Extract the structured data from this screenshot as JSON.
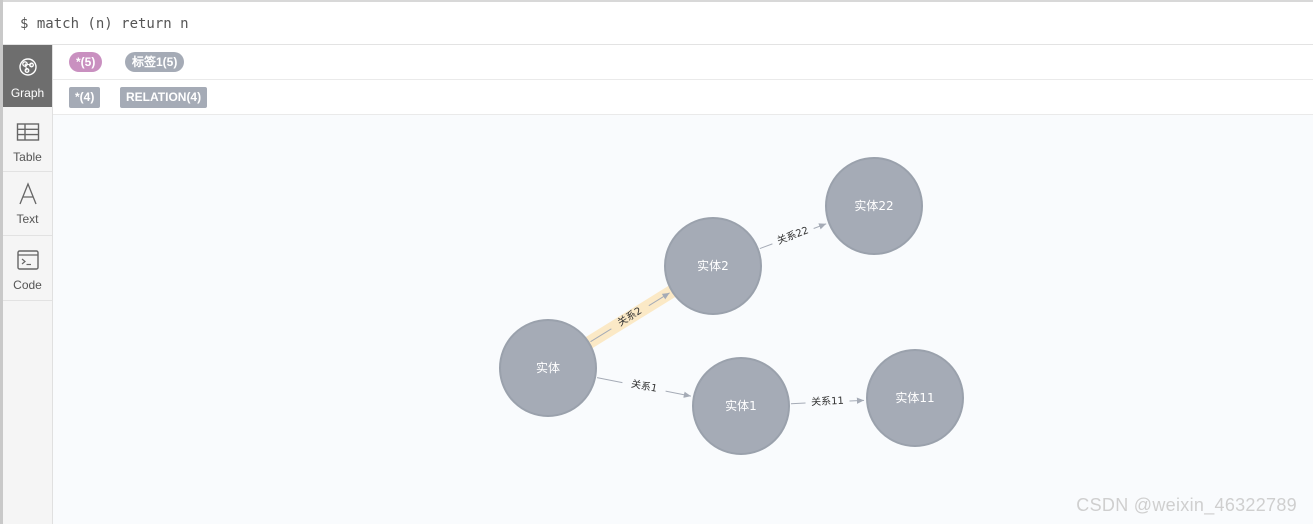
{
  "query": {
    "text": "$ match (n) return n"
  },
  "sidebar": {
    "items": [
      {
        "label": "Graph",
        "icon": "graph-icon",
        "active": true
      },
      {
        "label": "Table",
        "icon": "table-icon"
      },
      {
        "label": "Text",
        "icon": "text-icon"
      },
      {
        "label": "Code",
        "icon": "code-icon"
      }
    ]
  },
  "legend": {
    "node_labels": [
      {
        "text": "*(5)",
        "color": "#c990c0"
      },
      {
        "text": "标签1(5)",
        "color": "#a5abb6"
      }
    ],
    "relationship_types": [
      {
        "text": "*(4)"
      },
      {
        "text": "RELATION(4)"
      }
    ]
  },
  "graph": {
    "nodes": [
      {
        "id": "n0",
        "caption": "实体"
      },
      {
        "id": "n1",
        "caption": "实体2"
      },
      {
        "id": "n2",
        "caption": "实体22"
      },
      {
        "id": "n3",
        "caption": "实体1"
      },
      {
        "id": "n4",
        "caption": "实体11"
      }
    ],
    "relationships": [
      {
        "from": "n0",
        "to": "n1",
        "caption": "关系2",
        "highlighted": true
      },
      {
        "from": "n1",
        "to": "n2",
        "caption": "关系22"
      },
      {
        "from": "n0",
        "to": "n3",
        "caption": "关系1"
      },
      {
        "from": "n3",
        "to": "n4",
        "caption": "关系11"
      }
    ],
    "node_color": "#a5abb6",
    "node_border": "#9aa1ac",
    "highlight_color": "#fbe9c6"
  },
  "watermark": "CSDN @weixin_46322789"
}
